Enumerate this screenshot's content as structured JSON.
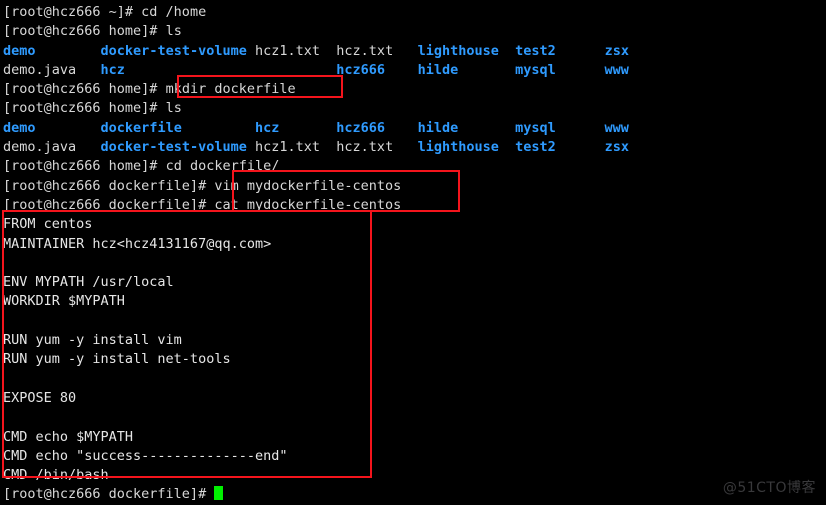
{
  "terminal": {
    "title": "root@hcz666: /home/dockerfile",
    "colors": {
      "background": "#000000",
      "foreground": "#d8d8d8",
      "directory_blue": "#2f9bff",
      "cursor_green": "#00f000",
      "annotation_red": "#f4141c",
      "watermark_gray": "#39393b"
    },
    "prompts": {
      "home_tilde": "[root@hcz666 ~]# ",
      "home": "[root@hcz666 home]# ",
      "dockerfile": "[root@hcz666 dockerfile]# "
    },
    "commands": {
      "cd_home": "cd /home",
      "ls_1": "ls",
      "mkdir": "mkdir dockerfile",
      "ls_2": "ls",
      "cd_dockerfile": "cd dockerfile/",
      "vim": "vim mydockerfile-centos",
      "cat": "cat mydockerfile-centos"
    },
    "ls_output_1": [
      [
        {
          "text": "demo",
          "type": "dir"
        },
        {
          "text": "docker-test-volume",
          "type": "dir"
        },
        {
          "text": "hcz1.txt",
          "type": "file"
        },
        {
          "text": "hcz.txt",
          "type": "file"
        },
        {
          "text": "lighthouse",
          "type": "dir"
        },
        {
          "text": "test2",
          "type": "dir"
        },
        {
          "text": "zsx",
          "type": "dir"
        }
      ],
      [
        {
          "text": "demo.java",
          "type": "file"
        },
        {
          "text": "hcz",
          "type": "dir"
        },
        {
          "text": "",
          "type": "file"
        },
        {
          "text": "hcz666",
          "type": "dir"
        },
        {
          "text": "hilde",
          "type": "dir"
        },
        {
          "text": "mysql",
          "type": "dir"
        },
        {
          "text": "www",
          "type": "dir"
        }
      ]
    ],
    "ls_output_2": [
      [
        {
          "text": "demo",
          "type": "dir"
        },
        {
          "text": "dockerfile",
          "type": "dir"
        },
        {
          "text": "hcz",
          "type": "dir"
        },
        {
          "text": "hcz666",
          "type": "dir"
        },
        {
          "text": "hilde",
          "type": "dir"
        },
        {
          "text": "mysql",
          "type": "dir"
        },
        {
          "text": "www",
          "type": "dir"
        }
      ],
      [
        {
          "text": "demo.java",
          "type": "file"
        },
        {
          "text": "docker-test-volume",
          "type": "dir"
        },
        {
          "text": "hcz1.txt",
          "type": "file"
        },
        {
          "text": "hcz.txt",
          "type": "file"
        },
        {
          "text": "lighthouse",
          "type": "dir"
        },
        {
          "text": "test2",
          "type": "dir"
        },
        {
          "text": "zsx",
          "type": "dir"
        }
      ]
    ],
    "dockerfile_content": [
      "FROM centos",
      "MAINTAINER hcz<hcz4131167@qq.com>",
      "",
      "ENV MYPATH /usr/local",
      "WORKDIR $MYPATH",
      "",
      "RUN yum -y install vim",
      "RUN yum -y install net-tools",
      "",
      "EXPOSE 80",
      "",
      "CMD echo $MYPATH",
      "CMD echo \"success--------------end\"",
      "CMD /bin/bash"
    ],
    "final_prompt": "[root@hcz666 dockerfile]# ",
    "watermark": "@51CTO博客"
  }
}
